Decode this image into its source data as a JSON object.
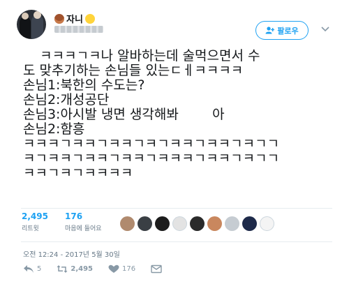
{
  "user": {
    "display_name": "자니",
    "avatar_icon": "profile-photo-two-people",
    "name_emojis": [
      "bear-face-emoji",
      "chick-emoji"
    ]
  },
  "follow_button": {
    "label": "팔로우",
    "icon": "add-user-icon"
  },
  "menu_icon": "chevron-down-icon",
  "tweet": {
    "lines": [
      "    ㅋㅋㅋㄱㅋ나 알바하는데 술먹으면서 수",
      "도 맞추기하는 손님들 있는ㄷㅔㅋㅋㅋㅋ",
      "손님1:북한의 수도는?",
      "손님2:개성공단",
      "손님3:아시발 냉면 생각해봐        아",
      "손님2:함흥",
      "ㅋㅋㅋㄱㅋㅋㄱㅋㅋㄱㅋㄱㅋㅋㄱㅋㅋㄱㅋㄱㄱ",
      "ㅋㄱㅋㅋㄱㅋㅋㄱㅋㅋㄱㅋㅋㅋㄱㅋㅋㄱㅋㄱㄱ",
      "ㅋㅋㄱㅋㄱㅋㅋㅋㅋ"
    ]
  },
  "stats": {
    "retweets": {
      "count": "2,495",
      "label": "리트윗"
    },
    "likes": {
      "count": "176",
      "label": "마음에 들어요"
    }
  },
  "likers_faces": [
    "#b08a6e",
    "#3a3f44",
    "#1c1c1c",
    "#e3e3e3",
    "#2a2a2a",
    "#c9875e",
    "#c6ccd2",
    "#1e2a4a",
    "#f4f4f4"
  ],
  "timestamp": "오전 12:24 - 2017년 5월 30일",
  "actions": {
    "reply_count": "5",
    "retweet_count": "2,495",
    "like_count": "176"
  },
  "colors": {
    "accent": "#1da1f2",
    "muted": "#657786"
  }
}
